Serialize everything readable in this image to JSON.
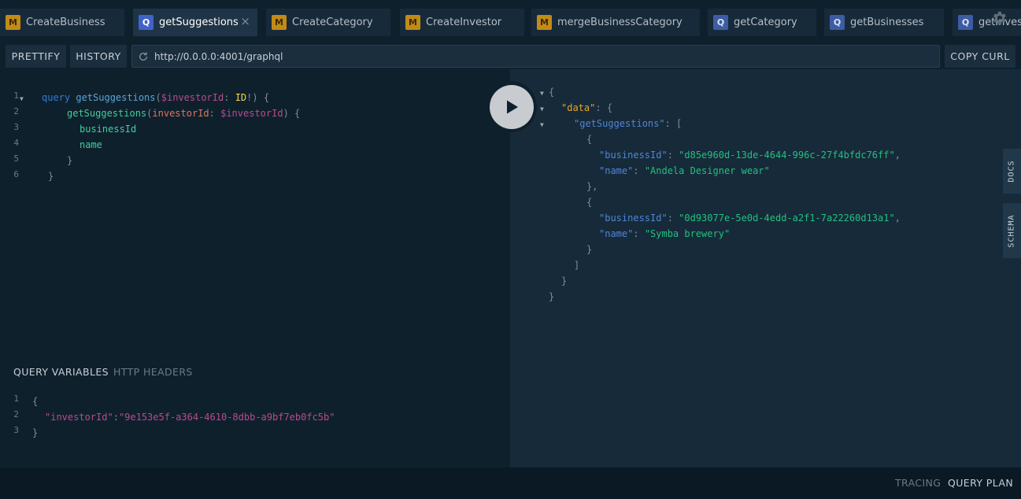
{
  "tabs": [
    {
      "type": "M",
      "label": "CreateBusiness"
    },
    {
      "type": "Q",
      "label": "getSuggestions",
      "close": "×"
    },
    {
      "type": "M",
      "label": "CreateCategory"
    },
    {
      "type": "M",
      "label": "CreateInvestor"
    },
    {
      "type": "M",
      "label": "mergeBusinessCategory"
    },
    {
      "type": "Q",
      "label": "getCategory"
    },
    {
      "type": "Q",
      "label": "getBusinesses"
    },
    {
      "type": "Q",
      "label": "getInves"
    }
  ],
  "toolbar": {
    "prettify": "PRETTIFY",
    "history": "HISTORY",
    "url": "http://0.0.0.0:4001/graphql",
    "copy_curl": "COPY CURL"
  },
  "query": {
    "line_numbers": [
      "1",
      "2",
      "3",
      "4",
      "5",
      "6"
    ],
    "tokens": {
      "l1_kw": "query",
      "l1_name": "getSuggestions",
      "l1_open": "(",
      "l1_var": "$investorId",
      "l1_colon": ": ",
      "l1_type": "ID",
      "l1_bang": "!",
      "l1_close": ") {",
      "l2_field": "getSuggestions",
      "l2_open": "(",
      "l2_arg": "investorId",
      "l2_colon": ": ",
      "l2_var": "$investorId",
      "l2_close": ") {",
      "l3": "businessId",
      "l4": "name",
      "l5": "}",
      "l6": "}"
    }
  },
  "result": {
    "open": "{",
    "data_key": "\"data\"",
    "colon": ": ",
    "data_open": "{",
    "suggestions_key": "\"getSuggestions\"",
    "array_open": "[",
    "items": [
      {
        "open": "{",
        "bid_key": "\"businessId\"",
        "bid_val": "\"d85e960d-13de-4644-996c-27f4bfdc76ff\"",
        "comma": ",",
        "name_key": "\"name\"",
        "name_val": "\"Andela Designer wear\"",
        "close": "},"
      },
      {
        "open": "{",
        "bid_key": "\"businessId\"",
        "bid_val": "\"0d93077e-5e0d-4edd-a2f1-7a22260d13a1\"",
        "comma": ",",
        "name_key": "\"name\"",
        "name_val": "\"Symba brewery\"",
        "close": "}"
      }
    ],
    "array_close": "]",
    "data_close": "}",
    "close": "}"
  },
  "side_tabs": {
    "docs": "DOCS",
    "schema": "SCHEMA"
  },
  "variables_panel": {
    "query_variables": "QUERY VARIABLES",
    "http_headers": "HTTP HEADERS",
    "line_numbers": [
      "1",
      "2",
      "3"
    ],
    "open": "{",
    "key": "\"investorId\"",
    "colon": ":",
    "value": "\"9e153e5f-a364-4610-8dbb-a9bf7eb0fc5b\"",
    "close": "}"
  },
  "footer": {
    "tracing": "TRACING",
    "query_plan": "QUERY PLAN"
  },
  "colors": {
    "background": "#0f202d",
    "results_bg": "#172a3a",
    "mutation_badge": "#c18b16",
    "query_badge": "#3f63c9"
  }
}
